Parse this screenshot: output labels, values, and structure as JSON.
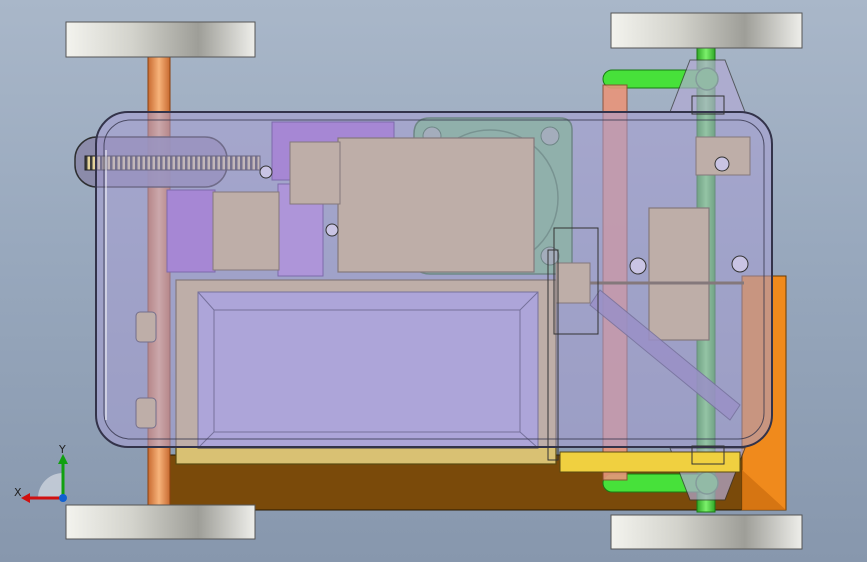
{
  "app": {
    "view": "top",
    "display_mode": "shaded-with-edges-transparent"
  },
  "colors": {
    "background_top": "#a9b7c9",
    "background_bottom": "#8797ad",
    "chassis_shell": "#a79fd4",
    "battery_pack": "#d9c173",
    "motor_body": "#d9c173",
    "gear_mount": "#a56ad6",
    "green_bracket": "#74c57a",
    "front_axle": "#f0a060",
    "rear_axle": "#58d84a",
    "wheel": "#d7d7d2",
    "base_plate": "#7a4a0a",
    "side_plate": "#f08a1c",
    "link_bar": "#47e13a"
  },
  "triad": {
    "x_label": "X",
    "y_label": "Y",
    "x_color": "#d01010",
    "y_color": "#10a010",
    "z_color": "#1060d0"
  }
}
